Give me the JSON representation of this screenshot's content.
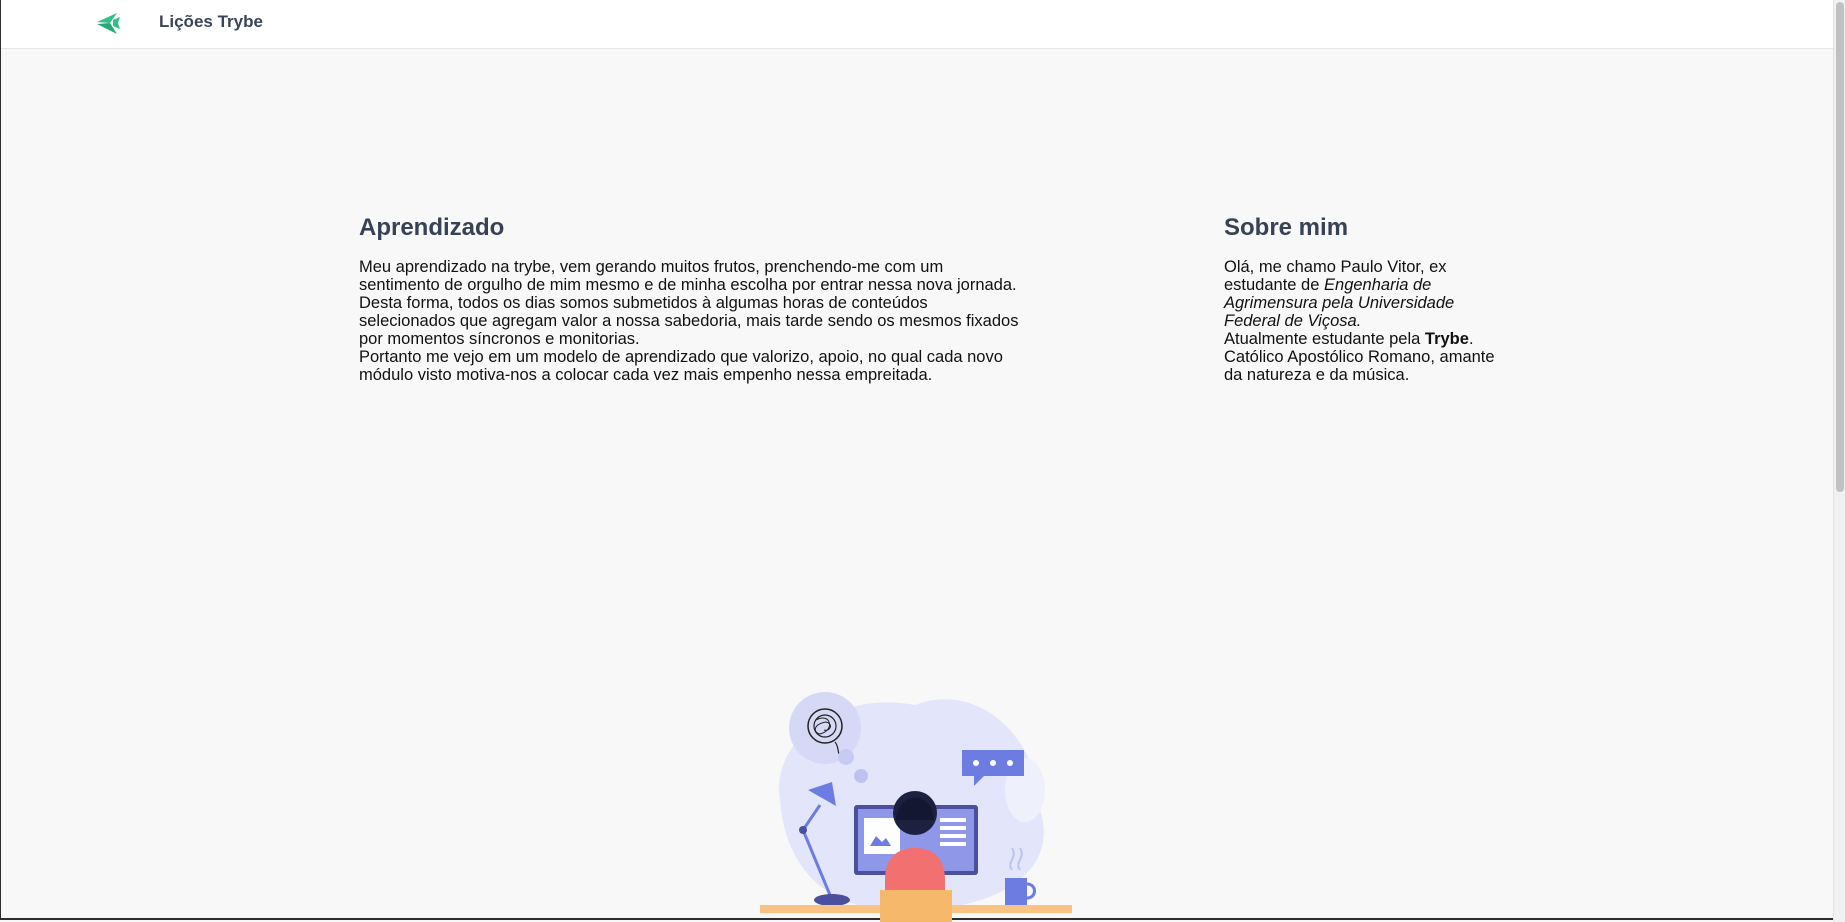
{
  "header": {
    "title": "Lições Trybe",
    "logo_icon": "trybe-logo-icon",
    "accent": "#2fc18c"
  },
  "learning": {
    "heading": "Aprendizado",
    "paragraphs": [
      "Meu aprendizado na trybe, vem gerando muitos frutos, prenchendo-me com um sentimento de orgulho de mim mesmo e de minha escolha por entrar nessa nova jornada.",
      "Desta forma, todos os dias somos submetidos à algumas horas de conteúdos selecionados que agregam valor a nossa sabedoria, mais tarde sendo os mesmos fixados por momentos síncronos e monitorias.",
      "Portanto me vejo em um modelo de aprendizado que valorizo, apoio, no qual cada novo módulo visto motiva-nos a colocar cada vez mais empenho nessa empreitada."
    ]
  },
  "about": {
    "heading": "Sobre mim",
    "line1": "Olá, me chamo Paulo Vitor, ex estudante de",
    "course": "Engenharia de Agrimensura pela Universidade Federal de Viçosa.",
    "line2": "Atualmente estudante pela",
    "school": "Trybe",
    "line2_end": ".",
    "line3": "Católico Apostólico Romano, amante da natureza e da música."
  },
  "illustration": {
    "name": "person-at-desk-illustration",
    "primary": "#6c7ce0",
    "secondary": "#f2706f"
  }
}
